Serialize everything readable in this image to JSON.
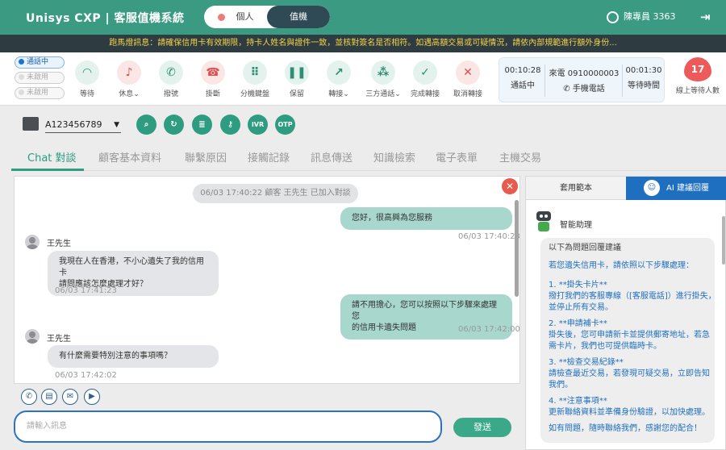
{
  "header": {
    "brand": "Unisys CXP | 客服值機系統",
    "mode_personal": "個人",
    "mode_value": "值機",
    "user_name": "陳專員 3363",
    "logout_symbol": "⇥"
  },
  "marquee": "跑馬燈訊息：請確保信用卡有效期限，持卡人姓名與證件一致，並核對簽名是否相符。如遇高額交易或可疑情況，請依內部規範進行額外身份...",
  "status": {
    "items": [
      {
        "label": "通話中",
        "active": true
      },
      {
        "label": "未啟用",
        "active": false
      },
      {
        "label": "未啟用",
        "active": false
      }
    ]
  },
  "toolbar": {
    "buttons": [
      {
        "label": "等待",
        "icon": "headset"
      },
      {
        "label": "休息",
        "icon": "bell-off"
      },
      {
        "label": "撥號",
        "icon": "phone"
      },
      {
        "label": "掛斷",
        "icon": "hangup"
      },
      {
        "label": "分機鍵盤",
        "icon": "dialpad"
      },
      {
        "label": "保留",
        "icon": "hold"
      },
      {
        "label": "轉接",
        "icon": "transfer"
      },
      {
        "label": "三方通話",
        "icon": "group"
      },
      {
        "label": "完成轉接",
        "icon": "done-transfer"
      },
      {
        "label": "取消轉接",
        "icon": "cancel-transfer"
      }
    ],
    "timer_call": "00:10:28",
    "timer_call_label": "通話中",
    "incoming_label": "來電",
    "incoming_number": "0910000003",
    "phone_type": "手機電話",
    "timer_wait": "00:01:30",
    "timer_wait_label": "等待時間",
    "queue_count": "17",
    "queue_label": "線上等待人數"
  },
  "search": {
    "customer_id": "A123456789",
    "buttons": [
      "search",
      "refresh",
      "inquiry",
      "key",
      "IVR",
      "OTP"
    ]
  },
  "tabs": [
    "Chat 對談",
    "顧客基本資料",
    "聯繫原因",
    "接觸記錄",
    "訊息傳送",
    "知識檢索",
    "電子表單",
    "主機交易"
  ],
  "chat": {
    "system_message": "06/03 17:40:22 顧客 王先生 已加入對談",
    "messages": [
      {
        "from": "agent",
        "lines": [
          "您好，很高興為您服務"
        ],
        "time": "06/03 17:40:23"
      },
      {
        "from": "customer",
        "sender": "王先生",
        "lines": [
          "我現在人在香港，不小心遺失了我的信用卡",
          "請問應該怎麼處理才好？"
        ],
        "time": "06/03 17:41:23"
      },
      {
        "from": "agent",
        "lines": [
          "請不用擔心，您可以按照以下步驟來處理您",
          "的信用卡遺失問題"
        ],
        "time": "06/03 17:42:00"
      },
      {
        "from": "customer",
        "sender": "王先生",
        "lines": [
          "有什麼需要特別注意的事項嗎？"
        ],
        "time": "06/03 17:42:02"
      }
    ],
    "input_placeholder": "請輸入訊息",
    "send_label": "發送"
  },
  "right_panel": {
    "tab_template": "套用範本",
    "tab_ai": "AI 建議回覆",
    "assistant_name": "智能助理",
    "intro": "以下為問題回覆建議",
    "suggestion_lines": [
      "若您遺失信用卡，請依照以下步驟處理：",
      "1. **掛失卡片**",
      "撥打我們的客服專線（[客服電話]）進行掛失，",
      "並停止所有交易。",
      "2. **申請補卡**",
      "掛失後，您可申請新卡並提供郵寄地址，若急",
      "需卡片，我們也可提供臨時卡。",
      "3. **檢查交易紀錄**",
      "請檢查最近交易，若發現可疑交易，立即告知",
      "我們。",
      "4. **注意事項**",
      "更新聯絡資料並準備身份驗證，以加快處理。",
      "如有問題，隨時聯絡我們，感謝您的配合！"
    ]
  },
  "colors": {
    "header": "#3a9b82",
    "marquee_bg": "#2e3b40",
    "marquee_text": "#f4d44a",
    "accent": "#2e9c80",
    "ai_blue": "#1f6fc0"
  }
}
